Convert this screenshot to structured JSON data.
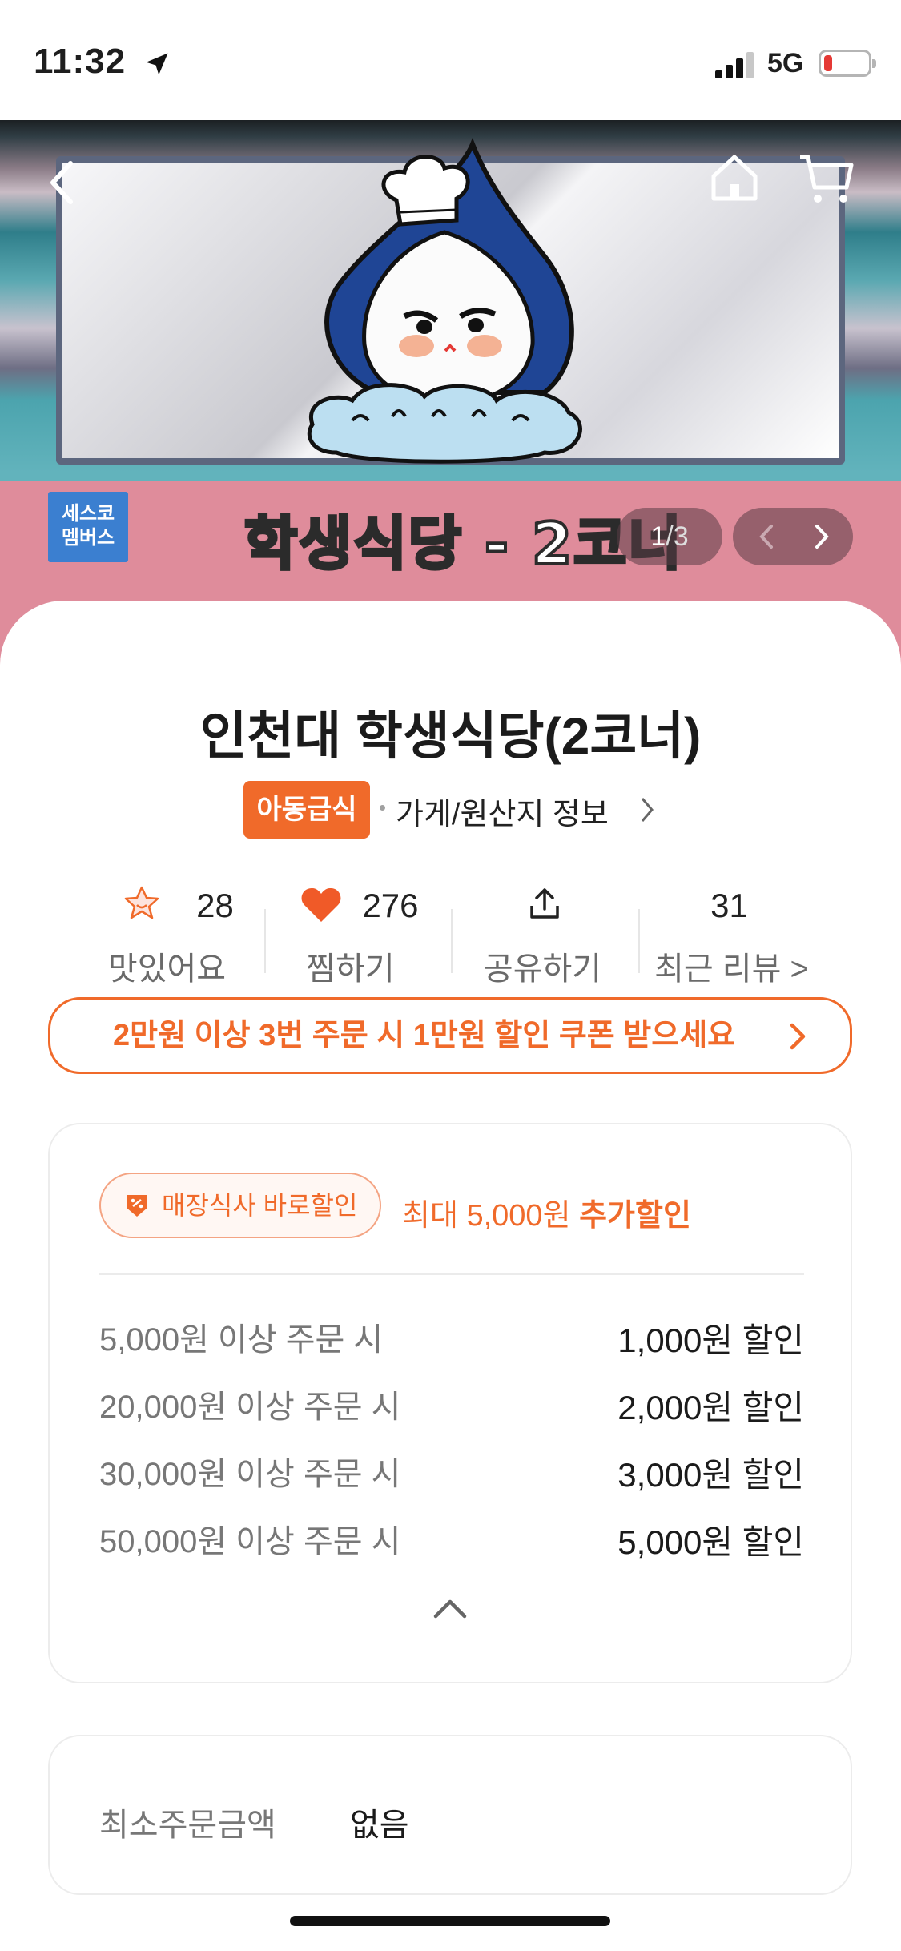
{
  "status_bar": {
    "time": "11:32",
    "network": "5G",
    "icons": [
      "location-arrow-icon",
      "signal-icon",
      "battery-icon"
    ]
  },
  "hero": {
    "sign_text": "학생식당 - 2코너",
    "badge": "세스코\n멤버스",
    "pager_current": "1",
    "pager_total": "/3",
    "icons": [
      "back-icon",
      "home-icon",
      "cart-icon",
      "prev-icon",
      "next-icon"
    ]
  },
  "store": {
    "title": "인천대 학생식당(2코너)",
    "tag": "아동급식",
    "info_link": "가게/원산지 정보"
  },
  "stats": [
    {
      "value": "28",
      "label": "맛있어요",
      "icon": "star-face-icon"
    },
    {
      "value": "276",
      "label": "찜하기",
      "icon": "heart-icon"
    },
    {
      "value": "",
      "label": "공유하기",
      "icon": "share-icon"
    },
    {
      "value": "31",
      "label": "최근 리뷰 >",
      "icon": ""
    }
  ],
  "coupon_banner": "2만원 이상 3번 주문 시 1만원 할인 쿠폰 받으세요",
  "discount": {
    "tag": "매장식사 바로할인",
    "max_prefix": "최대 5,000원 ",
    "max_suffix": "추가할인",
    "tiers": [
      {
        "condition": "5,000원 이상 주문 시",
        "amount": "1,000원 할인"
      },
      {
        "condition": "20,000원 이상 주문 시",
        "amount": "2,000원 할인"
      },
      {
        "condition": "30,000원 이상 주문 시",
        "amount": "3,000원 할인"
      },
      {
        "condition": "50,000원 이상 주문 시",
        "amount": "5,000원 할인"
      }
    ]
  },
  "min_order": {
    "label": "최소주문금액",
    "value": "없음"
  },
  "colors": {
    "accent": "#f06a2a",
    "heart": "#f05a28",
    "hero_pink": "#df8c9b",
    "sesco_blue": "#3b7fd0"
  }
}
